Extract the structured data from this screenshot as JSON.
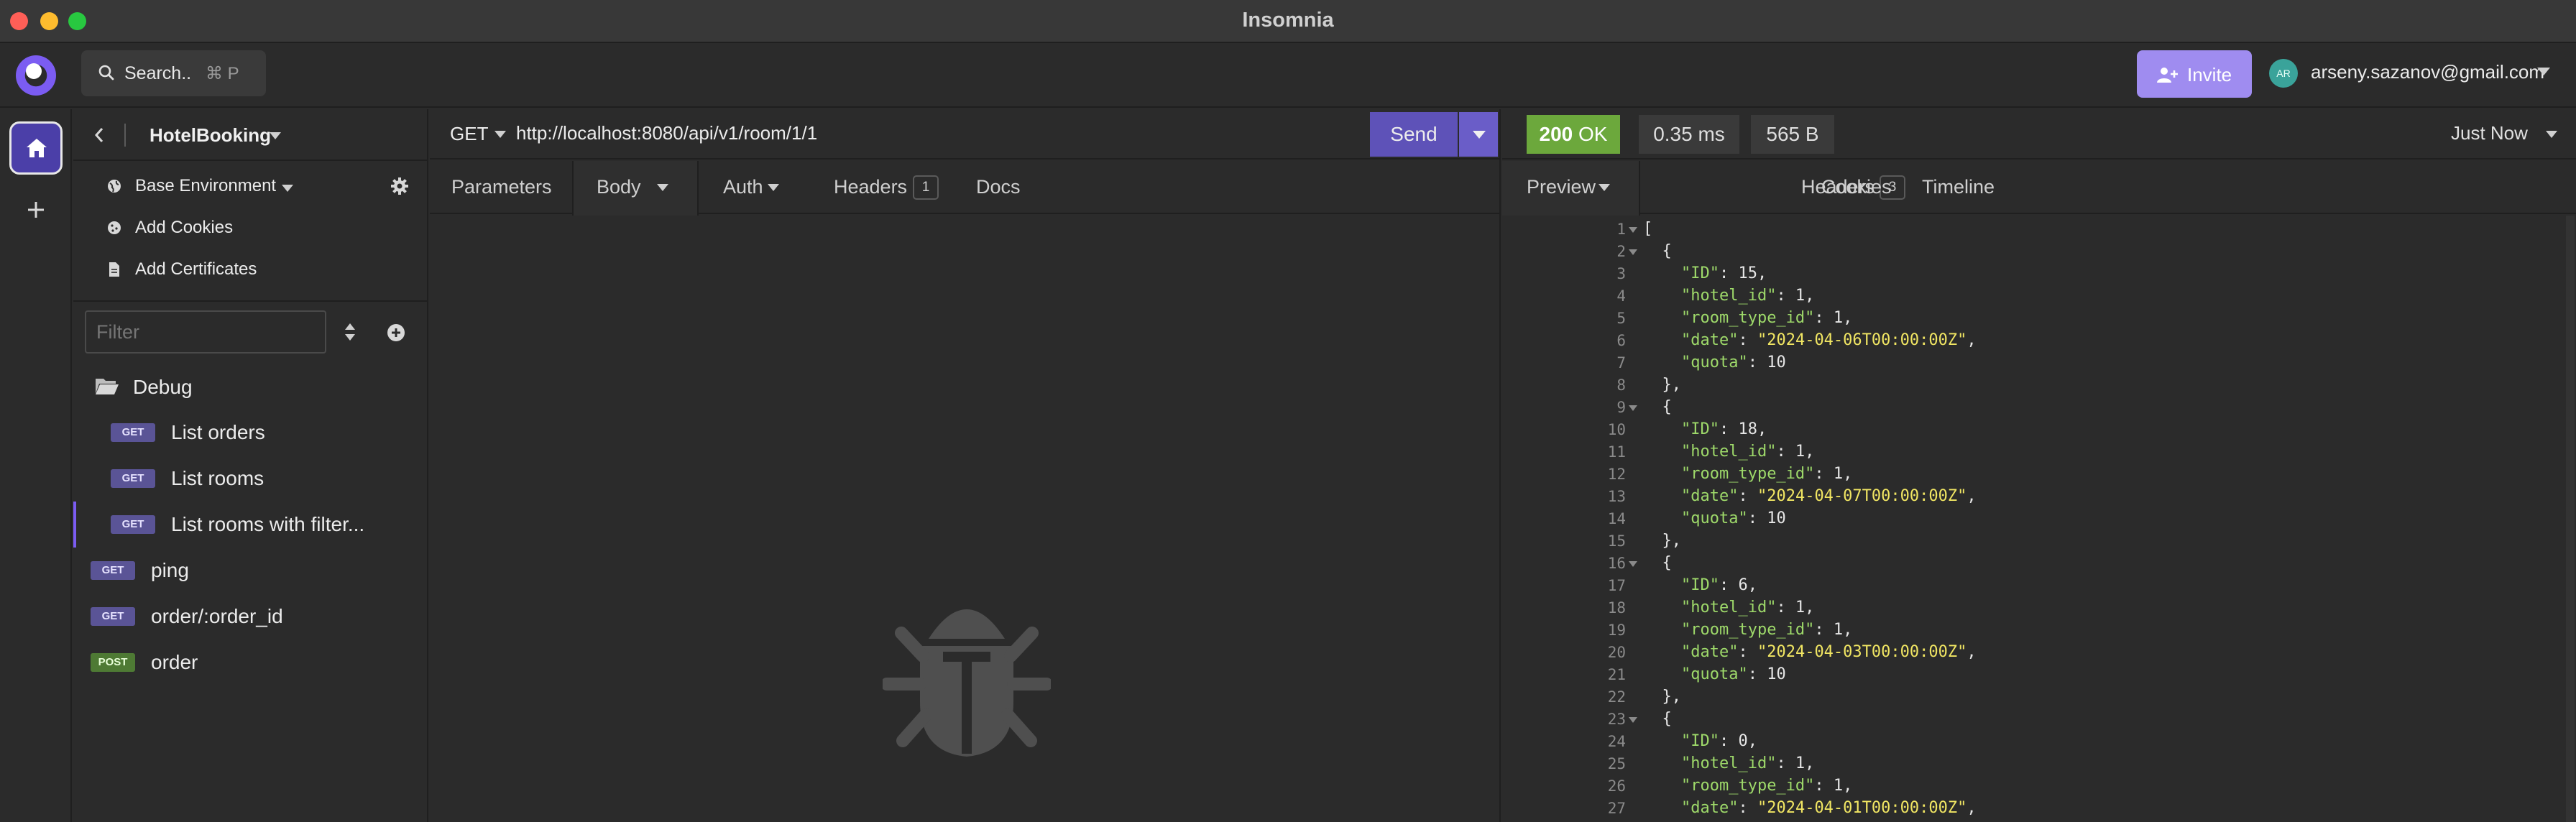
{
  "window": {
    "title": "Insomnia"
  },
  "appbar": {
    "search_label": "Search..",
    "search_shortcut": "⌘ P",
    "invite_label": "Invite",
    "user_initials": "AR",
    "user_email": "arseny.sazanov@gmail.com",
    "accent_color": "#7b5cf2"
  },
  "sidebar": {
    "project_name": "HotelBooking",
    "environment": "Base Environment",
    "add_cookies": "Add Cookies",
    "add_certificates": "Add Certificates",
    "filter_placeholder": "Filter",
    "folder": "Debug",
    "requests": [
      {
        "method": "GET",
        "name": "List orders"
      },
      {
        "method": "GET",
        "name": "List rooms"
      },
      {
        "method": "GET",
        "name": "List rooms with filter..."
      },
      {
        "method": "GET",
        "name": "ping"
      },
      {
        "method": "GET",
        "name": "order/:order_id"
      },
      {
        "method": "POST",
        "name": "order"
      }
    ]
  },
  "request": {
    "method": "GET",
    "url": "http://localhost:8080/api/v1/room/1/1",
    "send_label": "Send",
    "tabs": {
      "parameters": "Parameters",
      "body": "Body",
      "auth": "Auth",
      "headers": "Headers",
      "headers_count": "1",
      "docs": "Docs"
    }
  },
  "response": {
    "status_code": "200",
    "status_text": "OK",
    "time": "0.35 ms",
    "size": "565 B",
    "received": "Just Now",
    "tabs": {
      "preview": "Preview",
      "headers": "Headers",
      "headers_count": "3",
      "cookies": "Cookies",
      "timeline": "Timeline"
    },
    "lines": [
      {
        "n": "1",
        "fold": true,
        "parts": [
          [
            "p",
            "["
          ]
        ]
      },
      {
        "n": "2",
        "fold": true,
        "parts": [
          [
            "p",
            "  {"
          ]
        ]
      },
      {
        "n": "3",
        "parts": [
          [
            "p",
            "    "
          ],
          [
            "k",
            "\"ID\""
          ],
          [
            "p",
            ": 15,"
          ]
        ]
      },
      {
        "n": "4",
        "parts": [
          [
            "p",
            "    "
          ],
          [
            "k",
            "\"hotel_id\""
          ],
          [
            "p",
            ": 1,"
          ]
        ]
      },
      {
        "n": "5",
        "parts": [
          [
            "p",
            "    "
          ],
          [
            "k",
            "\"room_type_id\""
          ],
          [
            "p",
            ": 1,"
          ]
        ]
      },
      {
        "n": "6",
        "parts": [
          [
            "p",
            "    "
          ],
          [
            "k",
            "\"date\""
          ],
          [
            "p",
            ": "
          ],
          [
            "s",
            "\"2024-04-06T00:00:00Z\""
          ],
          [
            "p",
            ","
          ]
        ]
      },
      {
        "n": "7",
        "parts": [
          [
            "p",
            "    "
          ],
          [
            "k",
            "\"quota\""
          ],
          [
            "p",
            ": 10"
          ]
        ]
      },
      {
        "n": "8",
        "parts": [
          [
            "p",
            "  },"
          ]
        ]
      },
      {
        "n": "9",
        "fold": true,
        "parts": [
          [
            "p",
            "  {"
          ]
        ]
      },
      {
        "n": "10",
        "parts": [
          [
            "p",
            "    "
          ],
          [
            "k",
            "\"ID\""
          ],
          [
            "p",
            ": 18,"
          ]
        ]
      },
      {
        "n": "11",
        "parts": [
          [
            "p",
            "    "
          ],
          [
            "k",
            "\"hotel_id\""
          ],
          [
            "p",
            ": 1,"
          ]
        ]
      },
      {
        "n": "12",
        "parts": [
          [
            "p",
            "    "
          ],
          [
            "k",
            "\"room_type_id\""
          ],
          [
            "p",
            ": 1,"
          ]
        ]
      },
      {
        "n": "13",
        "parts": [
          [
            "p",
            "    "
          ],
          [
            "k",
            "\"date\""
          ],
          [
            "p",
            ": "
          ],
          [
            "s",
            "\"2024-04-07T00:00:00Z\""
          ],
          [
            "p",
            ","
          ]
        ]
      },
      {
        "n": "14",
        "parts": [
          [
            "p",
            "    "
          ],
          [
            "k",
            "\"quota\""
          ],
          [
            "p",
            ": 10"
          ]
        ]
      },
      {
        "n": "15",
        "parts": [
          [
            "p",
            "  },"
          ]
        ]
      },
      {
        "n": "16",
        "fold": true,
        "parts": [
          [
            "p",
            "  {"
          ]
        ]
      },
      {
        "n": "17",
        "parts": [
          [
            "p",
            "    "
          ],
          [
            "k",
            "\"ID\""
          ],
          [
            "p",
            ": 6,"
          ]
        ]
      },
      {
        "n": "18",
        "parts": [
          [
            "p",
            "    "
          ],
          [
            "k",
            "\"hotel_id\""
          ],
          [
            "p",
            ": 1,"
          ]
        ]
      },
      {
        "n": "19",
        "parts": [
          [
            "p",
            "    "
          ],
          [
            "k",
            "\"room_type_id\""
          ],
          [
            "p",
            ": 1,"
          ]
        ]
      },
      {
        "n": "20",
        "parts": [
          [
            "p",
            "    "
          ],
          [
            "k",
            "\"date\""
          ],
          [
            "p",
            ": "
          ],
          [
            "s",
            "\"2024-04-03T00:00:00Z\""
          ],
          [
            "p",
            ","
          ]
        ]
      },
      {
        "n": "21",
        "parts": [
          [
            "p",
            "    "
          ],
          [
            "k",
            "\"quota\""
          ],
          [
            "p",
            ": 10"
          ]
        ]
      },
      {
        "n": "22",
        "parts": [
          [
            "p",
            "  },"
          ]
        ]
      },
      {
        "n": "23",
        "fold": true,
        "parts": [
          [
            "p",
            "  {"
          ]
        ]
      },
      {
        "n": "24",
        "parts": [
          [
            "p",
            "    "
          ],
          [
            "k",
            "\"ID\""
          ],
          [
            "p",
            ": 0,"
          ]
        ]
      },
      {
        "n": "25",
        "parts": [
          [
            "p",
            "    "
          ],
          [
            "k",
            "\"hotel_id\""
          ],
          [
            "p",
            ": 1,"
          ]
        ]
      },
      {
        "n": "26",
        "parts": [
          [
            "p",
            "    "
          ],
          [
            "k",
            "\"room_type_id\""
          ],
          [
            "p",
            ": 1,"
          ]
        ]
      },
      {
        "n": "27",
        "parts": [
          [
            "p",
            "    "
          ],
          [
            "k",
            "\"date\""
          ],
          [
            "p",
            ": "
          ],
          [
            "s",
            "\"2024-04-01T00:00:00Z\""
          ],
          [
            "p",
            ","
          ]
        ]
      }
    ]
  }
}
